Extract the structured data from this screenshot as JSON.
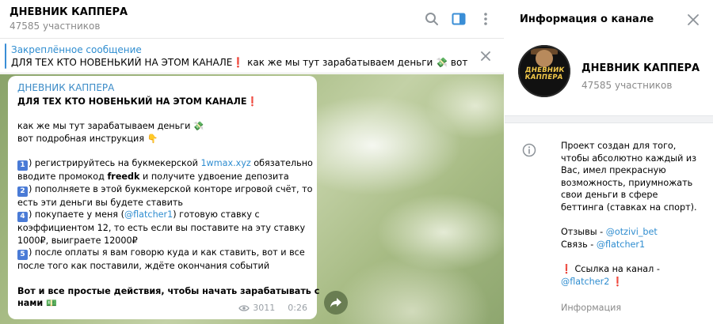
{
  "chat": {
    "title": "ДНЕВНИК КАППЕРА",
    "subtitle": "47585 участников",
    "icons": {
      "search": "search-icon",
      "panel": "sidebar-panel-icon",
      "more": "more-vertical-icon"
    }
  },
  "pinned": {
    "title": "Закреплённое сообщение",
    "text": "ДЛЯ ТЕХ КТО НОВЕНЬКИЙ НА ЭТОМ КАНАЛЕ❗ как же мы тут зарабатываем деньги 💸 вот подро..."
  },
  "message": {
    "author": "ДНЕВНИК КАППЕРА",
    "headline": "ДЛЯ ТЕХ КТО НОВЕНЬКИЙ НА ЭТОМ КАНАЛЕ",
    "intro1": "как же мы тут зарабатываем деньги",
    "intro2": "вот подробная инструкция",
    "step1_a": ") регистрируйтесь на букмекерской ",
    "step1_link": "1wmax.xyz",
    "step1_b": " обязательно",
    "step1_c": "вводите промокод ",
    "step1_code": "freedk",
    "step1_d": " и получите удвоение депозита",
    "step2_a": ") пополняете в этой букмекерской конторе игровой счёт, то",
    "step2_b": "есть эти деньги вы будете ставить",
    "step3_a": ") покупаете у меня (",
    "step3_link": "@flatcher1",
    "step3_b": ") готовую ставку с",
    "step3_c": "коэффициентом 12, то есть если вы поставите на эту ставку",
    "step3_d": "1000₽, выиграете 12000₽",
    "step4_a": ") после оплаты я вам говорю куда и как ставить, вот и все",
    "step4_b": "после того как поставили, ждёте окончания событий",
    "outro1": "Вот и все простые действия, чтобы начать зарабатывать с",
    "outro2": "нами",
    "nums": [
      "1",
      "2",
      "4",
      "5"
    ],
    "views": "3011",
    "time": "0:26"
  },
  "info": {
    "title": "Информация о канале",
    "channel_name": "ДНЕВНИК КАППЕРА",
    "subscribers": "47585 участников",
    "avatar_text": "ДНЕВНИК КАППЕРА",
    "desc1": "Проект создан для того,",
    "desc2": "чтобы абсолютно каждый из",
    "desc3": "Вас, имел прекрасную",
    "desc4": "возможность, приумножать",
    "desc5": "свои деньги в сфере",
    "desc6": "беттинга (ставках на спорт).",
    "reviews_label": "Отзывы - ",
    "reviews_link": "@otzivi_bet",
    "contact_label": "Связь - ",
    "contact_link": "@flatcher1",
    "channel_link_label": " Ссылка на канал -",
    "channel_link": "@flatcher2",
    "section_label": "Информация"
  },
  "colors": {
    "accent": "#2f8dd0",
    "red": "#d8241f",
    "muted": "#8a8a8a"
  }
}
